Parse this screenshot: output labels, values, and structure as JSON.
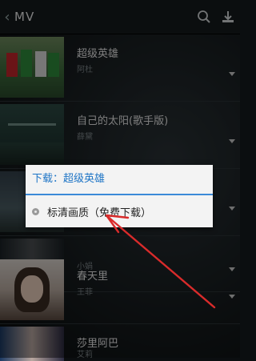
{
  "header": {
    "back_glyph": "‹",
    "title": "MV",
    "icons": [
      "search-icon",
      "download-icon"
    ]
  },
  "mv_list": [
    {
      "name": "超级英雄",
      "artist": "阿杜"
    },
    {
      "name": "自己的太阳(歌手版)",
      "artist": "薛黛"
    },
    {
      "name": "",
      "artist": ""
    },
    {
      "name": "",
      "artist": "小娟"
    },
    {
      "name": "春天里",
      "artist": "王菲"
    },
    {
      "name": "莎里阿巴",
      "artist": "艾莉"
    }
  ],
  "dialog": {
    "title": "下载：超级英雄",
    "option": "标清画质（免费下载）"
  },
  "colors": {
    "accent": "#1f75c6",
    "arrow": "#d92b2b"
  }
}
